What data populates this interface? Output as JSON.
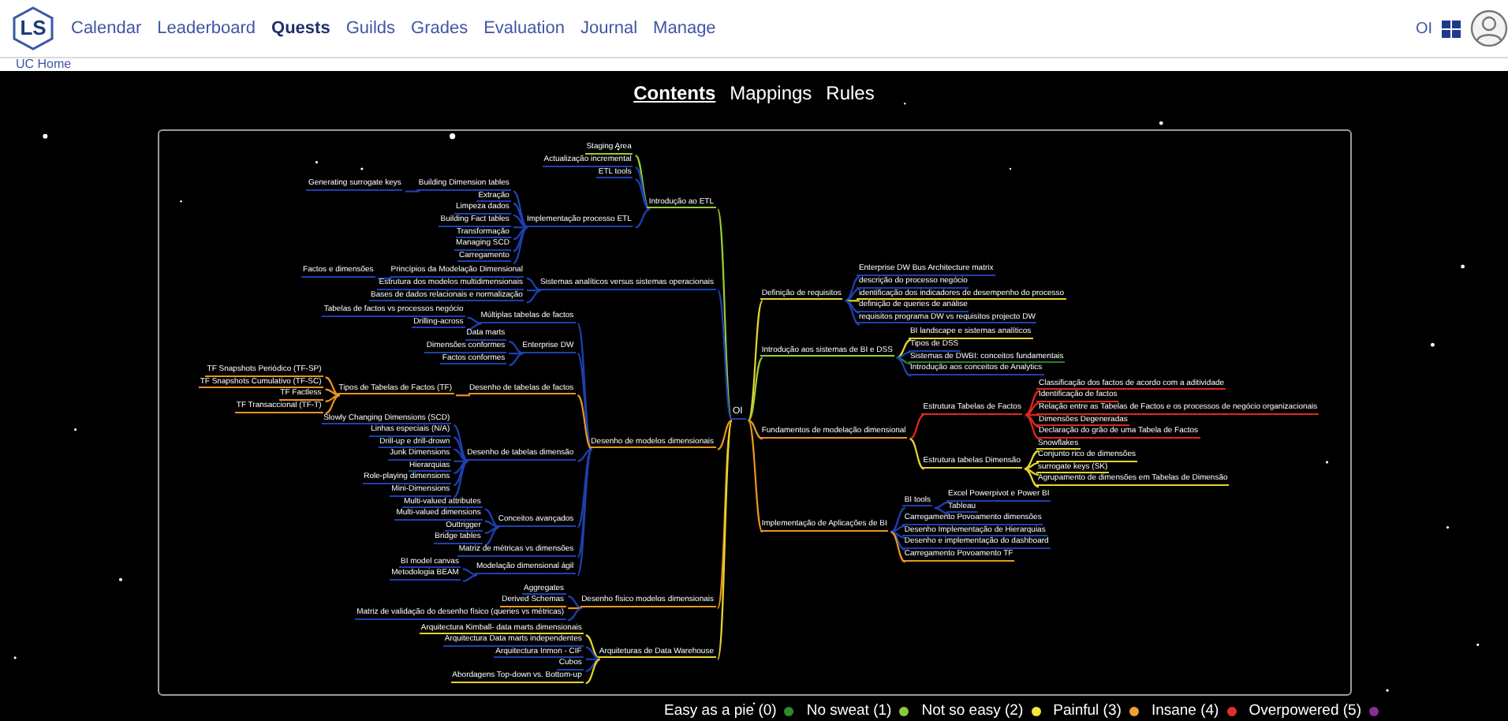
{
  "logo": "LS",
  "nav": [
    {
      "label": "Calendar",
      "selected": false
    },
    {
      "label": "Leaderboard",
      "selected": false
    },
    {
      "label": "Quests",
      "selected": true
    },
    {
      "label": "Guilds",
      "selected": false
    },
    {
      "label": "Grades",
      "selected": false
    },
    {
      "label": "Evaluation",
      "selected": false
    },
    {
      "label": "Journal",
      "selected": false
    },
    {
      "label": "Manage",
      "selected": false
    }
  ],
  "user_initials": "OI",
  "breadcrumb": "UC Home",
  "tabs": [
    {
      "label": "Contents",
      "selected": true
    },
    {
      "label": "Mappings",
      "selected": false
    },
    {
      "label": "Rules",
      "selected": false
    }
  ],
  "mindmap": {
    "root": {
      "label": "OI",
      "color": "#1e40af"
    },
    "left": [
      {
        "label": "Introdução ao ETL",
        "color": "#9acd32",
        "children": [
          {
            "label": "Staging Area",
            "color": "#9acd32"
          },
          {
            "label": "Actualização incremental",
            "color": "#1e40af"
          },
          {
            "label": "ETL tools",
            "color": "#1e40af"
          },
          {
            "label": "Implementação processo ETL",
            "color": "#1e40af",
            "children": [
              {
                "label": "Building Dimension tables",
                "color": "#1e40af",
                "children": [
                  {
                    "label": "Generating surrogate keys",
                    "color": "#1e40af"
                  }
                ]
              },
              {
                "label": "Extração",
                "color": "#1e40af"
              },
              {
                "label": "Limpeza dados",
                "color": "#1e40af"
              },
              {
                "label": "Building Fact tables",
                "color": "#1e40af"
              },
              {
                "label": "Transformação",
                "color": "#1e40af"
              },
              {
                "label": "Managing SCD",
                "color": "#1e40af"
              },
              {
                "label": "Carregamento",
                "color": "#1e40af"
              }
            ]
          }
        ]
      },
      {
        "label": "Sistemas analíticos versus sistemas operacionais",
        "color": "#1e40af",
        "children": [
          {
            "label": "Princípios da Modelação Dimensional",
            "color": "#1e40af",
            "children": [
              {
                "label": "Factos e dimensões",
                "color": "#1e40af"
              }
            ]
          },
          {
            "label": "Estrutura dos modelos multidimensionais",
            "color": "#1e40af"
          },
          {
            "label": "Bases de dados relacionais e normalização",
            "color": "#1e40af"
          }
        ]
      },
      {
        "label": "Desenho de modelos dimensionais",
        "color": "#e8961e",
        "children": [
          {
            "label": "Múltiplas tabelas de factos",
            "color": "#1e40af",
            "children": [
              {
                "label": "Tabelas de factos vs processos negócio",
                "color": "#1e40af"
              },
              {
                "label": "Drilling-across",
                "color": "#1e40af"
              }
            ]
          },
          {
            "label": "Enterprise DW",
            "color": "#1e40af",
            "children": [
              {
                "label": "Data marts",
                "color": "#1e40af"
              },
              {
                "label": "Dimensões conformes",
                "color": "#1e40af"
              },
              {
                "label": "Factos conformes",
                "color": "#1e40af"
              }
            ]
          },
          {
            "label": "Desenho de tabelas de factos",
            "color": "#e8961e",
            "children": [
              {
                "label": "Tipos de Tabelas de Factos (TF)",
                "color": "#e8961e",
                "children": [
                  {
                    "label": "TF Snapshots Periódico (TF-SP)",
                    "color": "#e8961e"
                  },
                  {
                    "label": "TF Snapshots Cumulativo (TF-SC)",
                    "color": "#e8961e"
                  },
                  {
                    "label": "TF Factless",
                    "color": "#e8961e"
                  },
                  {
                    "label": "TF Transaccional (TF-T)",
                    "color": "#e8961e"
                  }
                ]
              }
            ]
          },
          {
            "label": "Desenho de tabelas dimensão",
            "color": "#1e40af",
            "children": [
              {
                "label": "Slowly Changing Dimensions (SCD)",
                "color": "#1e40af"
              },
              {
                "label": "Linhas especiais (N/A)",
                "color": "#1e40af"
              },
              {
                "label": "Drill-up e drill-drown",
                "color": "#1e40af"
              },
              {
                "label": "Junk Dimensions",
                "color": "#1e40af"
              },
              {
                "label": "Hierarquias",
                "color": "#1e40af"
              },
              {
                "label": "Role-playing dimensions",
                "color": "#1e40af"
              },
              {
                "label": "Mini-Dimensions",
                "color": "#1e40af"
              }
            ]
          },
          {
            "label": "Conceitos avançados",
            "color": "#1e40af",
            "children": [
              {
                "label": "Multi-valued attributes",
                "color": "#1e40af"
              },
              {
                "label": "Multi-valued dimensions",
                "color": "#1e40af"
              },
              {
                "label": "Outtrigger",
                "color": "#1e40af"
              },
              {
                "label": "Bridge tables",
                "color": "#1e40af"
              }
            ]
          },
          {
            "label": "Matriz de métricas vs dimensões",
            "color": "#1e40af"
          },
          {
            "label": "Modelação dimensional ágil",
            "color": "#1e40af",
            "children": [
              {
                "label": "BI model canvas",
                "color": "#1e40af"
              },
              {
                "label": "Metodologia BEAM",
                "color": "#1e40af"
              }
            ]
          }
        ]
      },
      {
        "label": "Desenho físico modelos dimensionais",
        "color": "#e8961e",
        "children": [
          {
            "label": "Aggregates",
            "color": "#1e40af"
          },
          {
            "label": "Derived Schemas",
            "color": "#e8961e"
          },
          {
            "label": "Matriz de validação do desenho físico (queries vs métricas)",
            "color": "#1e40af"
          }
        ]
      },
      {
        "label": "Arquiteturas de Data Warehouse",
        "color": "#e6d52a",
        "children": [
          {
            "label": "Arquitectura Kimball- data marts dimensionais",
            "color": "#e6d52a"
          },
          {
            "label": "Arquitectura Data marts independentes",
            "color": "#1e40af"
          },
          {
            "label": "Arquitectura Inmon - CIF",
            "color": "#1e40af"
          },
          {
            "label": "Cubos",
            "color": "#1e40af"
          },
          {
            "label": "Abordagens Top-down vs. Bottom-up",
            "color": "#e6d52a"
          }
        ]
      }
    ],
    "right": [
      {
        "label": "Definição de requisitos",
        "color": "#e6d52a",
        "children": [
          {
            "label": "Enterprise DW Bus Architecture matrix",
            "color": "#1e40af"
          },
          {
            "label": "descrição do processo negócio",
            "color": "#1e40af"
          },
          {
            "label": "identificação dos indicadores de desempenho do processo",
            "color": "#e6d52a"
          },
          {
            "label": "definição de queries de análise",
            "color": "#1e40af"
          },
          {
            "label": "requisitos programa DW vs requisitos projecto DW",
            "color": "#1e40af"
          }
        ]
      },
      {
        "label": "Introdução aos sistemas de BI e DSS",
        "color": "#9acd32",
        "children": [
          {
            "label": "BI landscape e sistemas analíticos",
            "color": "#e6d52a"
          },
          {
            "label": "Tipos de DSS",
            "color": "#1e40af"
          },
          {
            "label": "Sistemas de DWBI: conceitos fundamentais",
            "color": "#2e7d32"
          },
          {
            "label": "Introdução aos conceitos de Analytics",
            "color": "#1e40af"
          }
        ]
      },
      {
        "label": "Fundamentos de modelação dimensional",
        "color": "#e8961e",
        "children": [
          {
            "label": "Estrutura Tabelas de Factos",
            "color": "#e0281e",
            "children": [
              {
                "label": "Classificação dos factos de acordo com a aditividade",
                "color": "#e0281e"
              },
              {
                "label": "Identificação de factos",
                "color": "#e0281e"
              },
              {
                "label": "Relação entre as Tabelas de Factos e os processos de negócio organizacionais",
                "color": "#e0281e"
              },
              {
                "label": "Dimensões Degeneradas",
                "color": "#e0281e"
              },
              {
                "label": "Declaração do grão de uma Tabela de Factos",
                "color": "#e0281e"
              }
            ]
          },
          {
            "label": "Estrutura tabelas Dimensão",
            "color": "#e6d52a",
            "children": [
              {
                "label": "Snowflakes",
                "color": "#e6d52a"
              },
              {
                "label": "Conjunto rico de dimensões",
                "color": "#e6d52a"
              },
              {
                "label": "surrogate keys (SK)",
                "color": "#e6d52a"
              },
              {
                "label": "Agrupamento de dimensões em Tabelas de Dimensão",
                "color": "#e6d52a"
              }
            ]
          }
        ]
      },
      {
        "label": "Implementação de Aplicações de BI",
        "color": "#e8961e",
        "children": [
          {
            "label": "BI tools",
            "color": "#1e40af",
            "children": [
              {
                "label": "Excel Powerpivot e Power BI",
                "color": "#1e40af"
              },
              {
                "label": "Tableau",
                "color": "#1e40af"
              }
            ]
          },
          {
            "label": "Carregamento Povoamento dimensões",
            "color": "#1e40af"
          },
          {
            "label": "Desenho Implementação de Hierarquias",
            "color": "#1e40af"
          },
          {
            "label": "Desenho e implementação do dashboard",
            "color": "#1e40af"
          },
          {
            "label": "Carregamento Povoamento  TF",
            "color": "#e8961e"
          }
        ]
      }
    ]
  },
  "legend": [
    {
      "label": "Easy as a pie (0)",
      "color": "#2e8b2e"
    },
    {
      "label": "No sweat (1)",
      "color": "#8cc63f"
    },
    {
      "label": "Not so easy (2)",
      "color": "#f5e63b"
    },
    {
      "label": "Painful (3)",
      "color": "#f0a030"
    },
    {
      "label": "Insane (4)",
      "color": "#e0302a"
    },
    {
      "label": "Overpowered (5)",
      "color": "#8b2a9a"
    }
  ]
}
